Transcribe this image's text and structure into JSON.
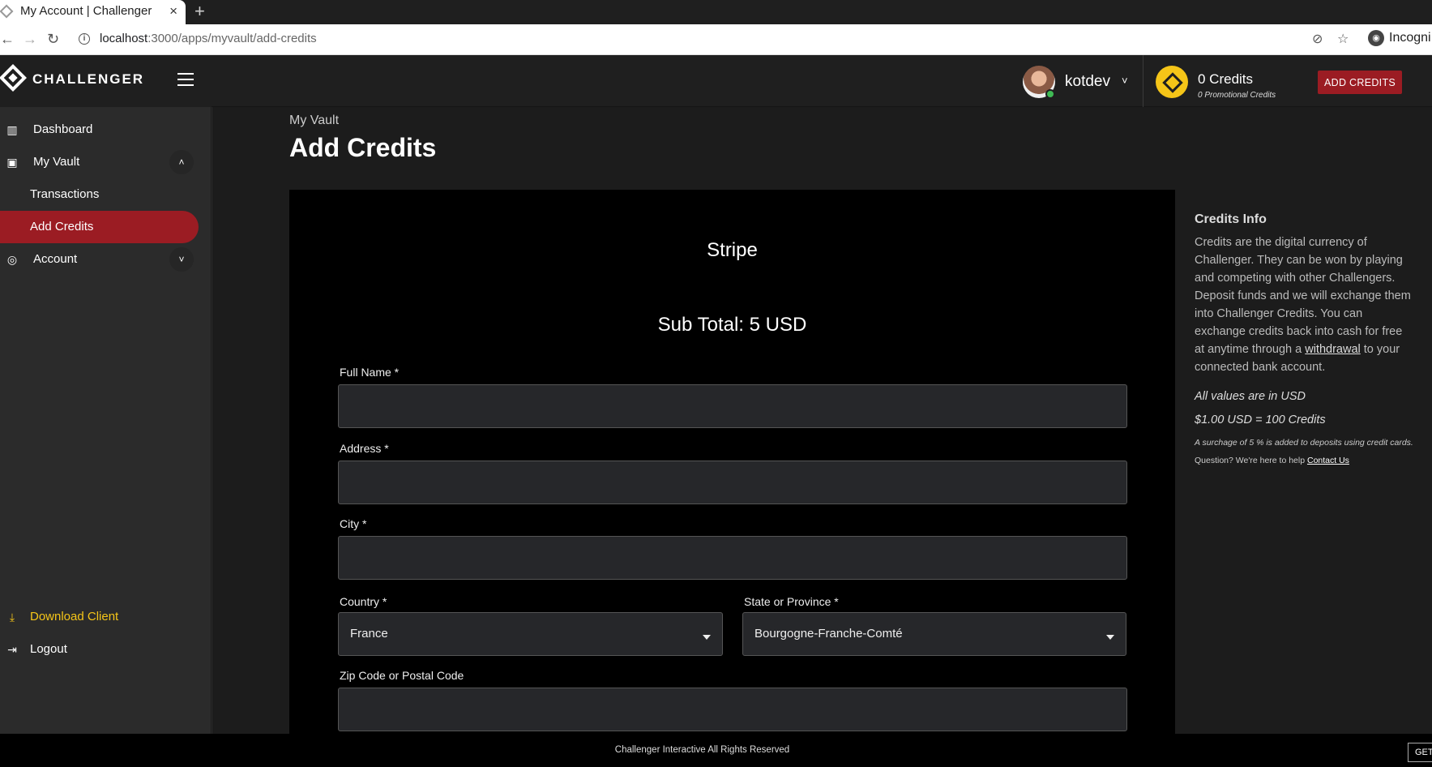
{
  "browser": {
    "tab_title": "My Account | Challenger",
    "tab_close": "×",
    "new_tab": "+",
    "url_host": "localhost",
    "url_path": ":3000/apps/myvault/add-credits",
    "incognito_label": "Incogni"
  },
  "brand": {
    "name": "CHALLENGER"
  },
  "sidebar": {
    "dashboard": "Dashboard",
    "my_vault": "My Vault",
    "transactions": "Transactions",
    "add_credits": "Add Credits",
    "account": "Account",
    "download_client": "Download Client",
    "logout": "Logout"
  },
  "header": {
    "username": "kotdev",
    "credits": "0 Credits",
    "promotional": "0 Promotional Credits",
    "add_credits_button": "ADD CREDITS"
  },
  "main": {
    "breadcrumb": "My Vault",
    "title": "Add Credits",
    "provider": "Stripe",
    "subtotal": "Sub Total: 5 USD",
    "form": {
      "full_name_label": "Full Name *",
      "address_label": "Address *",
      "city_label": "City *",
      "country_label": "Country *",
      "country_value": "France",
      "state_label": "State or Province *",
      "state_value": "Bourgogne-Franche-Comté",
      "zip_label": "Zip Code or Postal Code"
    }
  },
  "info": {
    "title": "Credits Info",
    "body_before": "Credits are the digital currency of Challenger. They can be won by playing and competing with other Challengers. Deposit funds and we will exchange them into Challenger Credits. You can exchange credits back into cash for free at anytime through a ",
    "withdrawal_link": "withdrawal",
    "body_after": " to your connected bank account.",
    "usd_note": "All values are in USD",
    "rate": "$1.00 USD = 100 Credits",
    "surcharge": "A surchage of 5 % is added to deposits using credit cards.",
    "question": "Question? We're here to help ",
    "contact_link": "Contact Us"
  },
  "footer": {
    "text": "Challenger Interactive All Rights Reserved",
    "get_button": "GET"
  },
  "colors": {
    "accent_red": "#9b1c23",
    "gold": "#f5c518",
    "online_green": "#3fba54"
  }
}
